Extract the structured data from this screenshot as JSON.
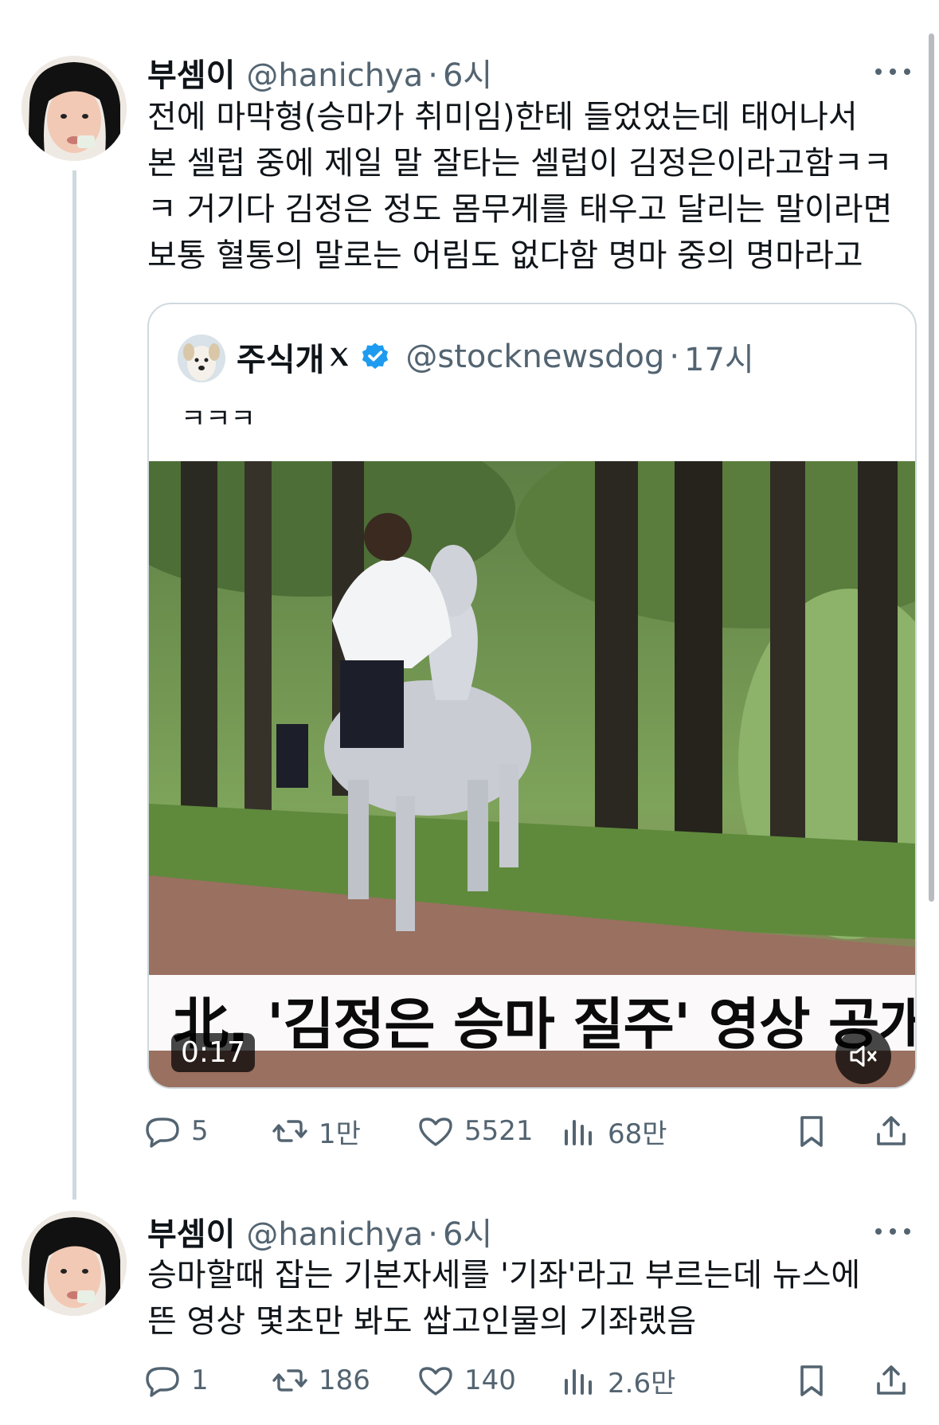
{
  "tweets": [
    {
      "name": "부셈이",
      "handle": "@hanichya",
      "time": "6시",
      "text": "전에 마막형(승마가 취미임)한테 들었었는데 태어나서\n본 셀럽 중에 제일 말 잘타는 셀럽이 김정은이라고함ㅋㅋ\nㅋ 거기다 김정은 정도 몸무게를 태우고 달리는 말이라면\n보통 혈통의 말로는 어림도 없다함 명마 중의 명마라고",
      "quote": {
        "name": "주식개",
        "handle": "@stocknewsdog",
        "time": "17시",
        "text": "ㅋㅋㅋ",
        "video": {
          "caption": "北, '김정은 승마 질주' 영상 공개",
          "duration": "0:17"
        }
      },
      "stats": {
        "replies": "5",
        "retweets": "1만",
        "likes": "5521",
        "views": "68만"
      }
    },
    {
      "name": "부셈이",
      "handle": "@hanichya",
      "time": "6시",
      "text": "승마할때 잡는 기본자세를 '기좌'라고 부르는데 뉴스에\n뜬 영상 몇초만 봐도 쌉고인물의 기좌랬음",
      "stats": {
        "replies": "1",
        "retweets": "186",
        "likes": "140",
        "views": "2.6만"
      }
    }
  ],
  "icons": {
    "reply": "reply-icon",
    "retweet": "retweet-icon",
    "like": "heart-icon",
    "views": "views-icon",
    "bookmark": "bookmark-icon",
    "share": "share-icon",
    "more": "more-icon",
    "verified": "verified-badge-icon",
    "mute": "mute-icon"
  },
  "colors": {
    "text": "#0f1419",
    "secondary": "#536471",
    "border": "#cfd9de",
    "verified": "#1d9bf0"
  }
}
